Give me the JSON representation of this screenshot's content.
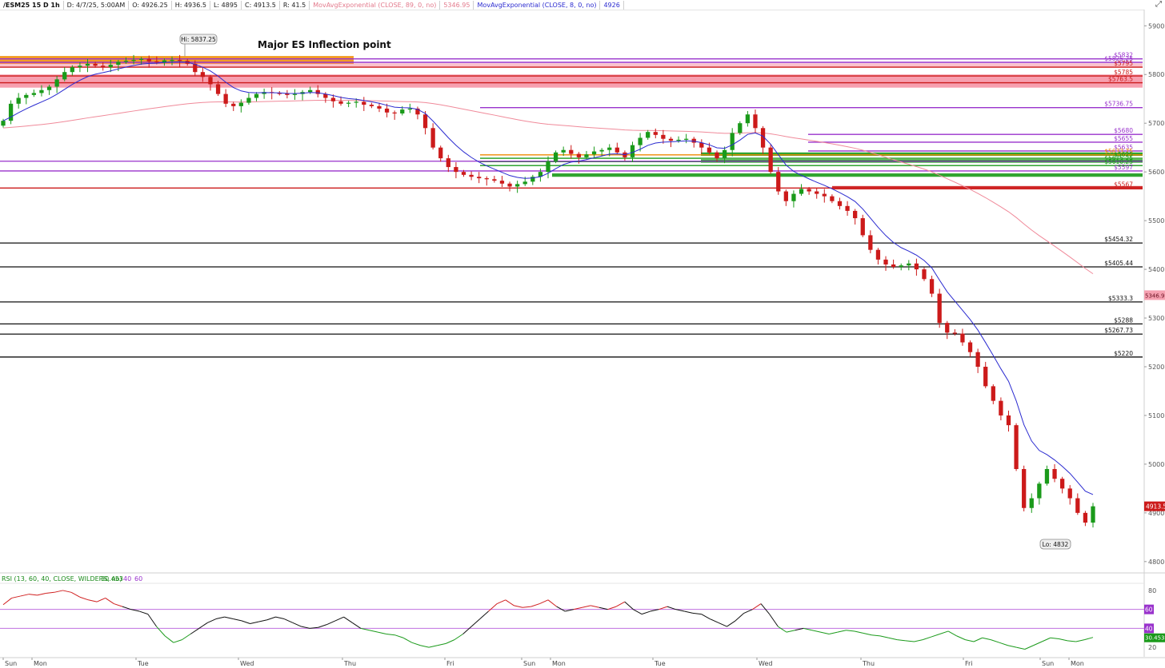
{
  "header": {
    "symbol": "/ESM25 15 D 1h",
    "date": "D: 4/7/25, 5:00AM",
    "open": "O: 4926.25",
    "high": "H: 4936.5",
    "low": "L: 4895",
    "close": "C: 4913.5",
    "range": "R: 41.5",
    "ema89_label": "MovAvgExponential (CLOSE, 89, 0, no)",
    "ema89_value": "5346.95",
    "ema8_label": "MovAvgExponential (CLOSE, 8, 0, no)",
    "ema8_value": "4926"
  },
  "icons": {
    "corner": "expand-icon"
  },
  "colors": {
    "up": "#1a9a1a",
    "down": "#cc1a1a",
    "rsi_up": "#1a9a1a",
    "rsi_down": "#111111",
    "ema8": "#2b2bd0",
    "ema89": "#f08a9a",
    "purple": "#9932cc",
    "zone_pink": "#f0506e",
    "zone_orange": "#ee8a00"
  },
  "annotations": {
    "title": "Major ES Inflection point",
    "hi_label": "Hi: 5837.25",
    "lo_label": "Lo: 4832"
  },
  "chart_data": [
    {
      "type": "candlestick",
      "title": "Major ES Inflection point",
      "ylim": [
        4780,
        5930
      ],
      "yticks": [
        "5900",
        "5800",
        "5700",
        "5600",
        "5500",
        "5400",
        "5300",
        "5200",
        "5100",
        "5000",
        "4900",
        "4800"
      ],
      "x_day_labels": [
        "Sun",
        "Mon",
        "Tue",
        "Wed",
        "Thu",
        "Fri",
        "Sun",
        "Mon",
        "Tue",
        "Wed",
        "Thu",
        "Fri",
        "Sun",
        "Mon"
      ],
      "price_labels": {
        "last": "4913.5",
        "ema89": "5346.95"
      },
      "level_lines": [
        {
          "label": "$5832",
          "value": 5832,
          "color": "#9932cc"
        },
        {
          "label": "$5825.25",
          "value": 5825,
          "color": "#9932cc"
        },
        {
          "label": "$5795",
          "value": 5815,
          "color": "#cc1a1a"
        },
        {
          "label": "$5785",
          "value": 5797,
          "color": "#cc1a1a"
        },
        {
          "label": "$5763.5",
          "value": 5783,
          "color": "#cc1a1a"
        },
        {
          "label": "$5736.75",
          "value": 5732,
          "color": "#9932cc"
        },
        {
          "label": "$5680",
          "value": 5677,
          "color": "#9932cc"
        },
        {
          "label": "$5655",
          "value": 5661,
          "color": "#9932cc"
        },
        {
          "label": "$5635",
          "value": 5643,
          "color": "#9932cc"
        },
        {
          "label": "$5633.75",
          "value": 5635,
          "color": "#ee8a00"
        },
        {
          "label": "$5625",
          "value": 5628,
          "color": "#1a9a1a"
        },
        {
          "label": "$5615.25",
          "value": 5621,
          "color": "#1a9a1a"
        },
        {
          "label": "$5610.25",
          "value": 5613,
          "color": "#1a9a1a"
        },
        {
          "label": "$5597",
          "value": 5602,
          "color": "#9932cc"
        },
        {
          "label": "$5567",
          "value": 5567,
          "color": "#cc1a1a"
        },
        {
          "label": "$5454.32",
          "value": 5454,
          "color": "#111111"
        },
        {
          "label": "$5405.44",
          "value": 5405,
          "color": "#111111"
        },
        {
          "label": "$5333.3",
          "value": 5333,
          "color": "#111111"
        },
        {
          "label": "$5288",
          "value": 5288,
          "color": "#111111"
        },
        {
          "label": "$5267.73",
          "value": 5267,
          "color": "#111111"
        },
        {
          "label": "$5220",
          "value": 5220,
          "color": "#111111"
        }
      ],
      "price_series": [
        5705,
        5740,
        5752,
        5758,
        5762,
        5768,
        5775,
        5790,
        5805,
        5815,
        5818,
        5822,
        5818,
        5815,
        5820,
        5826,
        5828,
        5830,
        5832,
        5827,
        5825,
        5829,
        5830,
        5828,
        5822,
        5805,
        5795,
        5780,
        5760,
        5740,
        5735,
        5742,
        5752,
        5760,
        5764,
        5762,
        5761,
        5758,
        5760,
        5764,
        5768,
        5760,
        5752,
        5745,
        5740,
        5742,
        5744,
        5738,
        5735,
        5730,
        5722,
        5720,
        5728,
        5730,
        5718,
        5690,
        5650,
        5628,
        5610,
        5600,
        5594,
        5590,
        5587,
        5585,
        5582,
        5576,
        5570,
        5575,
        5580,
        5590,
        5600,
        5622,
        5640,
        5645,
        5637,
        5630,
        5636,
        5642,
        5645,
        5650,
        5640,
        5630,
        5655,
        5670,
        5682,
        5676,
        5668,
        5664,
        5666,
        5668,
        5660,
        5650,
        5640,
        5628,
        5645,
        5680,
        5700,
        5718,
        5690,
        5650,
        5600,
        5560,
        5540,
        5555,
        5565,
        5560,
        5555,
        5550,
        5540,
        5530,
        5520,
        5505,
        5470,
        5440,
        5420,
        5410,
        5405,
        5408,
        5412,
        5400,
        5380,
        5350,
        5290,
        5270,
        5268,
        5250,
        5230,
        5200,
        5160,
        5130,
        5100,
        5080,
        4990,
        4910,
        4930,
        4960,
        4990,
        4970,
        4950,
        4930,
        4900,
        4880,
        4913.5
      ],
      "annotation_points": [
        {
          "label": "Hi: 5837.25",
          "value": 5837.25
        },
        {
          "label": "Lo: 4832",
          "value": 4832
        }
      ]
    },
    {
      "type": "line",
      "name": "RSI",
      "legend": "RSI (13, 60, 40, CLOSE, WILDERS, no)",
      "value": "30.453",
      "levels": [
        "40",
        "60"
      ],
      "ylim": [
        10,
        85
      ],
      "yticks": [
        "80",
        "20"
      ],
      "level_labels": {
        "upper": "60",
        "lower": "40",
        "last": "30.453"
      },
      "values": [
        65,
        72,
        74,
        76,
        75,
        77,
        78,
        80,
        78,
        73,
        70,
        68,
        72,
        66,
        63,
        60,
        58,
        55,
        42,
        32,
        25,
        28,
        34,
        40,
        46,
        50,
        52,
        50,
        48,
        45,
        47,
        49,
        52,
        50,
        46,
        42,
        40,
        41,
        44,
        48,
        52,
        46,
        40,
        38,
        36,
        34,
        33,
        30,
        25,
        22,
        20,
        22,
        24,
        28,
        34,
        42,
        50,
        58,
        66,
        70,
        64,
        62,
        63,
        66,
        70,
        63,
        58,
        60,
        62,
        64,
        62,
        60,
        63,
        68,
        60,
        55,
        58,
        60,
        63,
        60,
        58,
        56,
        55,
        50,
        46,
        42,
        48,
        56,
        60,
        66,
        55,
        42,
        36,
        38,
        40,
        38,
        36,
        34,
        36,
        38,
        37,
        35,
        33,
        32,
        30,
        28,
        27,
        26,
        28,
        31,
        34,
        37,
        32,
        28,
        26,
        30,
        28,
        25,
        22,
        20,
        18,
        22,
        26,
        30,
        29,
        27,
        26,
        28,
        30.5
      ]
    }
  ]
}
